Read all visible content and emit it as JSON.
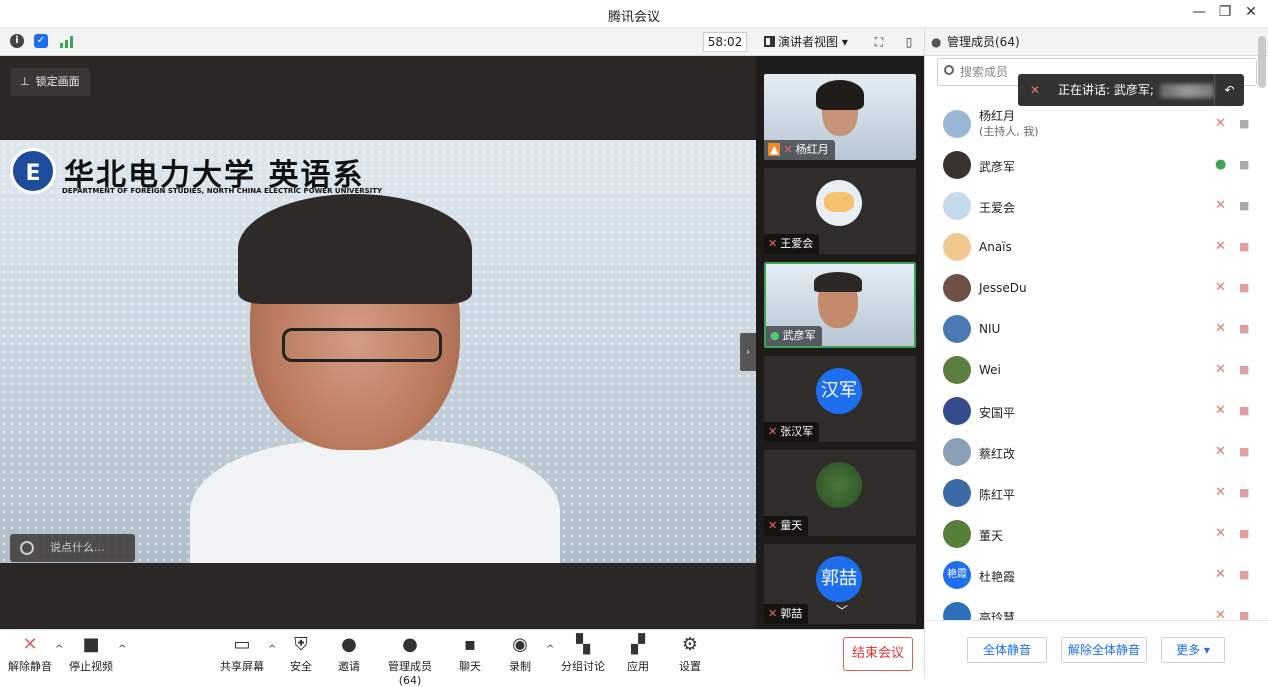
{
  "app": {
    "title": "腾讯会议"
  },
  "window_controls": {
    "minimize": "—",
    "restore": "❐",
    "close": "✕"
  },
  "toolbar": {
    "timer": "58:02",
    "view_label": "演讲者视图",
    "view_caret": "▾"
  },
  "stage": {
    "lock_label": "锁定画面",
    "chat_placeholder": "说点什么...",
    "collapse_arrow": "›",
    "background_title": "华北电力大学 英语系",
    "background_subtitle": "DEPARTMENT OF FOREIGN STUDIES, NORTH CHINA ELECTRIC POWER UNIVERSITY"
  },
  "strip": {
    "up": "︿",
    "down": "﹀",
    "tiles": [
      {
        "name": "杨红月"
      },
      {
        "name": "王爱会"
      },
      {
        "name": "武彦军"
      },
      {
        "name": "张汉军",
        "initials": "汉军"
      },
      {
        "name": "童天"
      },
      {
        "name": "郭喆",
        "initials": "郭喆"
      }
    ]
  },
  "panel": {
    "header": "管理成员(64)",
    "search_placeholder": "搜索成员",
    "speaking_prefix": "正在讲话: 武彦军;",
    "members": [
      {
        "name": "杨红月",
        "sub": "(主持人, 我)",
        "mic": "muted"
      },
      {
        "name": "武彦军",
        "sub": "",
        "mic": "on"
      },
      {
        "name": "王爱会",
        "sub": "",
        "mic": "muted"
      },
      {
        "name": "Anaïs",
        "sub": "",
        "mic": "muted"
      },
      {
        "name": "JesseDu",
        "sub": "",
        "mic": "muted"
      },
      {
        "name": "NIU",
        "sub": "",
        "mic": "muted"
      },
      {
        "name": "Wei",
        "sub": "",
        "mic": "muted"
      },
      {
        "name": "安国平",
        "sub": "",
        "mic": "muted"
      },
      {
        "name": "蔡红改",
        "sub": "",
        "mic": "muted"
      },
      {
        "name": "陈红平",
        "sub": "",
        "mic": "muted"
      },
      {
        "name": "董天",
        "sub": "",
        "mic": "muted"
      },
      {
        "name": "杜艳霞",
        "sub": "",
        "mic": "muted",
        "initials": "艳霞"
      },
      {
        "name": "高玲慧",
        "sub": "",
        "mic": "muted"
      }
    ],
    "footer": {
      "mute_all": "全体静音",
      "unmute_all": "解除全体静音",
      "more": "更多 ▾"
    }
  },
  "bottombar": {
    "unmute": "解除静音",
    "stop_video": "停止视频",
    "share": "共享屏幕",
    "security": "安全",
    "invite": "邀请",
    "manage": "管理成员(64)",
    "chat": "聊天",
    "record": "录制",
    "breakout": "分组讨论",
    "apps": "应用",
    "settings": "设置",
    "end": "结束会议"
  },
  "colors": {
    "accent": "#1e6ff0",
    "danger": "#e06060",
    "speaking_green": "#3fa45a"
  }
}
